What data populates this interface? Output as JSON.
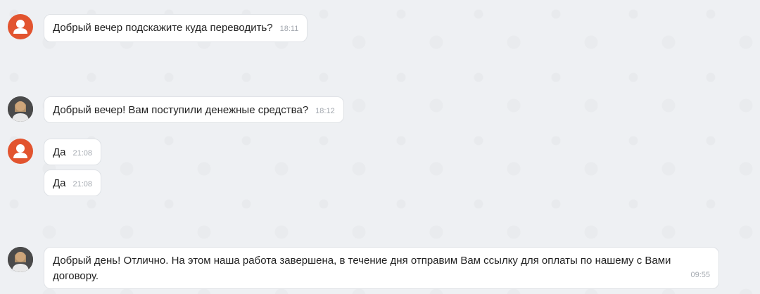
{
  "messages": [
    {
      "text": "Добрый вечер подскажите куда переводить?",
      "time": "18:11"
    },
    {
      "text": "Добрый вечер! Вам поступили денежные средства?",
      "time": "18:12"
    },
    {
      "text": "Да",
      "time": "21:08"
    },
    {
      "text": "Да",
      "time": "21:08"
    },
    {
      "text": "Добрый день! Отлично. На этом наша работа завершена, в течение дня отправим Вам ссылку для оплаты по нашему с Вами договору.",
      "time": "09:55"
    }
  ]
}
